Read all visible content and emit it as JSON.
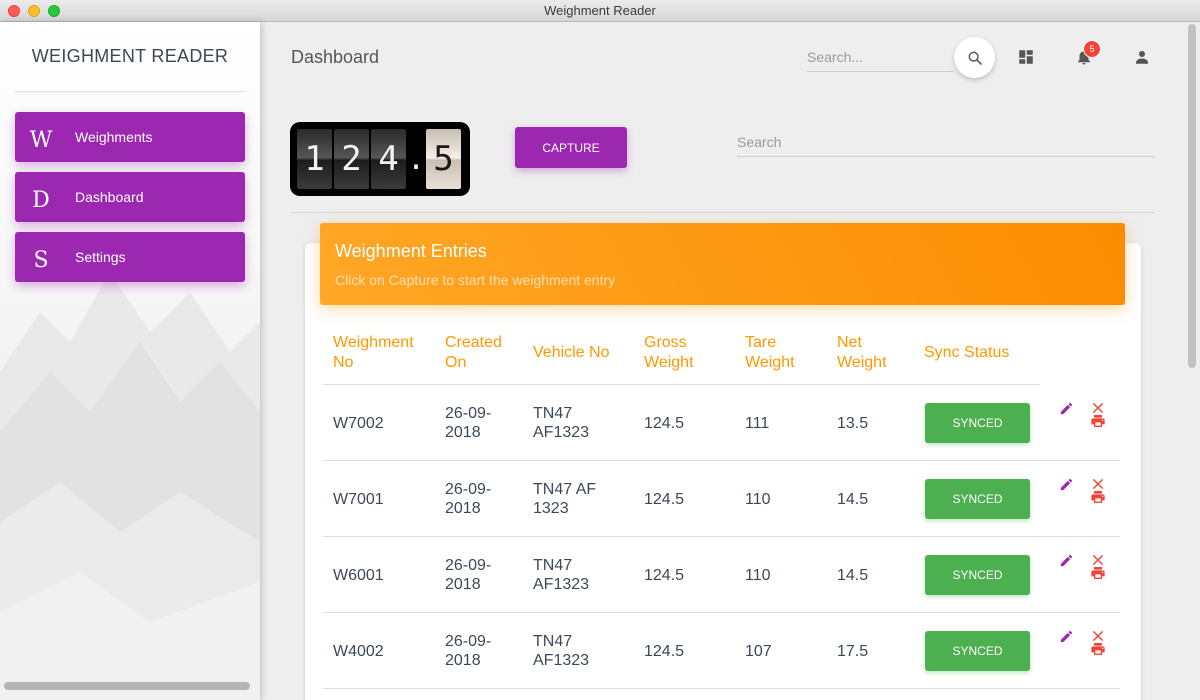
{
  "window": {
    "title": "Weighment Reader"
  },
  "sidebar": {
    "brand": "WEIGHMENT READER",
    "items": [
      {
        "letter": "W",
        "label": "Weighments"
      },
      {
        "letter": "D",
        "label": "Dashboard"
      },
      {
        "letter": "S",
        "label": "Settings"
      }
    ]
  },
  "header": {
    "title": "Dashboard",
    "search_placeholder": "Search...",
    "notification_count": "5"
  },
  "scale": {
    "digits": [
      "1",
      "2",
      "4"
    ],
    "decimal": ".",
    "fraction": "5"
  },
  "toolbar": {
    "capture_label": "CAPTURE",
    "search_placeholder": "Search"
  },
  "card": {
    "title": "Weighment Entries",
    "subtitle": "Click on Capture to start the weighment entry"
  },
  "table": {
    "headers": [
      [
        "Weighment",
        "No"
      ],
      [
        "Created",
        "On"
      ],
      [
        "Vehicle No"
      ],
      [
        "Gross",
        "Weight"
      ],
      [
        "Tare",
        "Weight"
      ],
      [
        "Net",
        "Weight"
      ],
      [
        "Sync Status"
      ]
    ],
    "rows": [
      {
        "no": "W7002",
        "created": [
          "26-09-",
          "2018"
        ],
        "vehicle": [
          "TN47",
          "AF1323"
        ],
        "gross": "124.5",
        "tare": "111",
        "net": "13.5",
        "status": "SYNCED"
      },
      {
        "no": "W7001",
        "created": [
          "26-09-",
          "2018"
        ],
        "vehicle": [
          "TN47 AF",
          "1323"
        ],
        "gross": "124.5",
        "tare": "110",
        "net": "14.5",
        "status": "SYNCED"
      },
      {
        "no": "W6001",
        "created": [
          "26-09-",
          "2018"
        ],
        "vehicle": [
          "TN47",
          "AF1323"
        ],
        "gross": "124.5",
        "tare": "110",
        "net": "14.5",
        "status": "SYNCED"
      },
      {
        "no": "W4002",
        "created": [
          "26-09-",
          "2018"
        ],
        "vehicle": [
          "TN47",
          "AF1323"
        ],
        "gross": "124.5",
        "tare": "107",
        "net": "17.5",
        "status": "SYNCED"
      }
    ]
  },
  "colors": {
    "primary": "#9c27b0",
    "accent": "#ff9800",
    "success": "#4caf50",
    "danger": "#f44336"
  },
  "icons": {
    "search": "search-icon",
    "dashboard": "dashboard-icon",
    "notifications": "bell-icon",
    "account": "person-icon",
    "edit": "pencil-icon",
    "delete": "close-icon",
    "print": "printer-icon"
  }
}
